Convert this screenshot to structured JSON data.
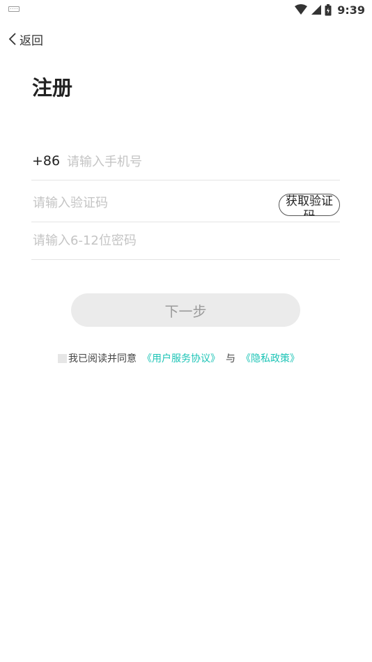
{
  "status_bar": {
    "time": "9:39",
    "icons": [
      "keyboard-icon",
      "wifi-icon",
      "cell-signal-icon",
      "battery-icon"
    ]
  },
  "nav": {
    "back_label": "返回"
  },
  "page": {
    "title": "注册"
  },
  "form": {
    "country_code": "+86",
    "phone_placeholder": "请输入手机号",
    "code_placeholder": "请输入验证码",
    "get_code_label": "获取验证码",
    "password_placeholder": "请输入6-12位密码",
    "next_label": "下一步"
  },
  "agreement": {
    "prefix": "我已阅读并同意",
    "terms_link": "《用户服务协议》",
    "separator": "与",
    "privacy_link": "《隐私政策》"
  },
  "colors": {
    "link": "#1cc4b6",
    "button_bg": "#ebebeb",
    "button_text": "#9a9a9a",
    "placeholder": "#c4c4c4"
  }
}
